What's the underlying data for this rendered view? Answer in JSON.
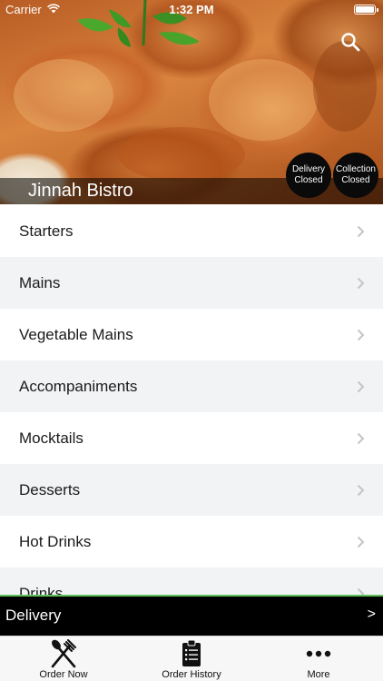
{
  "status_bar": {
    "carrier": "Carrier",
    "time": "1:32 PM"
  },
  "header": {
    "restaurant_name": "Jinnah Bistro",
    "delivery_status": {
      "line1": "Delivery",
      "line2": "Closed"
    },
    "collection_status": {
      "line1": "Collection",
      "line2": "Closed"
    },
    "search_icon": "search-icon"
  },
  "menu": {
    "categories": [
      "Starters",
      "Mains",
      "Vegetable Mains",
      "Accompaniments",
      "Mocktails",
      "Desserts",
      "Hot Drinks",
      "Drinks"
    ]
  },
  "delivery_bar": {
    "label": "Delivery",
    "arrow": ">"
  },
  "tab_bar": {
    "tabs": [
      {
        "label": "Order Now",
        "icon": "fork-knife-icon"
      },
      {
        "label": "Order History",
        "icon": "clipboard-icon"
      },
      {
        "label": "More",
        "icon": "ellipsis-icon"
      }
    ]
  },
  "colors": {
    "accent_line": "#5fbf57",
    "delivery_bar_bg": "#000000",
    "list_row_alt": "#f2f3f5"
  }
}
